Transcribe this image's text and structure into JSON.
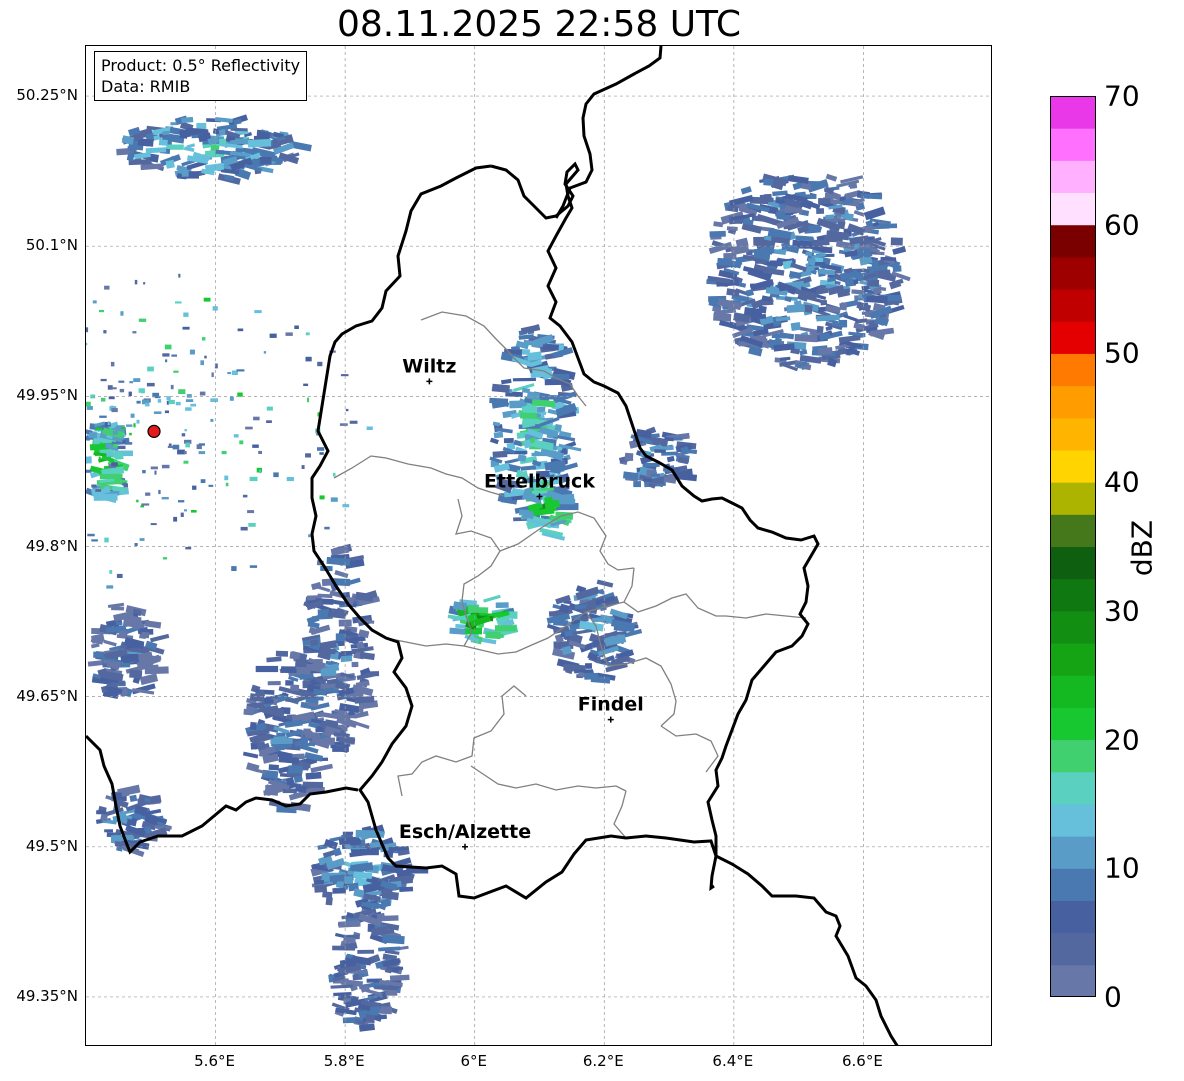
{
  "title": "08.11.2025 22:58 UTC",
  "info": {
    "product": "Product: 0.5° Reflectivity",
    "source": "Data: RMIB"
  },
  "axes": {
    "lat_ticks": [
      "50.25°N",
      "50.1°N",
      "49.95°N",
      "49.8°N",
      "49.65°N",
      "49.5°N",
      "49.35°N"
    ],
    "lon_ticks": [
      "5.6°E",
      "5.8°E",
      "6°E",
      "6.2°E",
      "6.4°E",
      "6.6°E"
    ],
    "lat_values": [
      50.25,
      50.1,
      49.95,
      49.8,
      49.65,
      49.5,
      49.35
    ],
    "lon_values": [
      5.6,
      5.8,
      6.0,
      6.2,
      6.4,
      6.6
    ],
    "extent": {
      "lon_min": 5.4,
      "lon_max": 6.8,
      "lat_min": 49.3,
      "lat_max": 50.3
    },
    "grid": true
  },
  "cities": [
    {
      "name": "Wiltz",
      "lon": 5.93,
      "lat": 49.965
    },
    {
      "name": "Ettelbruck",
      "lon": 6.1,
      "lat": 49.85
    },
    {
      "name": "Findel",
      "lon": 6.21,
      "lat": 49.627
    },
    {
      "name": "Esch/Alzette",
      "lon": 5.985,
      "lat": 49.5
    }
  ],
  "radar_site": {
    "lon": 5.505,
    "lat": 49.915,
    "color": "#e41a1c"
  },
  "colorbar": {
    "label": "dBZ",
    "ticks": [
      "0",
      "10",
      "20",
      "30",
      "40",
      "50",
      "60",
      "70"
    ],
    "tick_values": [
      0,
      10,
      20,
      30,
      40,
      50,
      60,
      70
    ],
    "step": 2.5,
    "colors": [
      "#6778a8",
      "#5468a0",
      "#4660a0",
      "#4a78b0",
      "#5a9cc8",
      "#66c0dc",
      "#5ad0c0",
      "#40d070",
      "#18c830",
      "#14b820",
      "#14a414",
      "#128e12",
      "#107810",
      "#0e6010",
      "#44781a",
      "#acb400",
      "#ffd400",
      "#ffb400",
      "#ff9c00",
      "#ff7a00",
      "#e40000",
      "#c00000",
      "#9e0000",
      "#7a0000",
      "#ffe0ff",
      "#ffb0ff",
      "#ff70ff",
      "#e838e8"
    ]
  },
  "chart_data": {
    "type": "heatmap",
    "title": "08.11.2025 22:58 UTC",
    "xlabel": "",
    "ylabel": "",
    "value_label": "dBZ",
    "value_range": [
      0,
      70
    ],
    "xlim": [
      5.4,
      6.8
    ],
    "ylim": [
      49.3,
      50.3
    ],
    "echo_areas": [
      {
        "lon": 5.42,
        "lat": 49.89,
        "r_lon": 0.03,
        "r_lat": 0.04,
        "dbz": 20
      },
      {
        "lon": 5.58,
        "lat": 50.2,
        "r_lon": 0.14,
        "r_lat": 0.03,
        "dbz": 12
      },
      {
        "lon": 6.08,
        "lat": 49.92,
        "r_lon": 0.06,
        "r_lat": 0.1,
        "dbz": 14
      },
      {
        "lon": 6.1,
        "lat": 49.84,
        "r_lon": 0.03,
        "r_lat": 0.03,
        "dbz": 22
      },
      {
        "lon": 6.0,
        "lat": 49.73,
        "r_lon": 0.05,
        "r_lat": 0.02,
        "dbz": 24
      },
      {
        "lon": 6.17,
        "lat": 49.72,
        "r_lon": 0.06,
        "r_lat": 0.05,
        "dbz": 8
      },
      {
        "lon": 6.5,
        "lat": 50.08,
        "r_lon": 0.15,
        "r_lat": 0.1,
        "dbz": 8
      },
      {
        "lon": 6.27,
        "lat": 49.89,
        "r_lon": 0.05,
        "r_lat": 0.03,
        "dbz": 8
      },
      {
        "lon": 5.82,
        "lat": 49.48,
        "r_lon": 0.08,
        "r_lat": 0.04,
        "dbz": 10
      },
      {
        "lon": 5.82,
        "lat": 49.38,
        "r_lon": 0.05,
        "r_lat": 0.06,
        "dbz": 6
      },
      {
        "lon": 5.45,
        "lat": 49.7,
        "r_lon": 0.05,
        "r_lat": 0.05,
        "dbz": 6
      },
      {
        "lon": 5.7,
        "lat": 49.62,
        "r_lon": 0.06,
        "r_lat": 0.08,
        "dbz": 6
      },
      {
        "lon": 5.78,
        "lat": 49.7,
        "r_lon": 0.05,
        "r_lat": 0.1,
        "dbz": 6
      },
      {
        "lon": 5.46,
        "lat": 49.53,
        "r_lon": 0.05,
        "r_lat": 0.03,
        "dbz": 8
      }
    ]
  }
}
